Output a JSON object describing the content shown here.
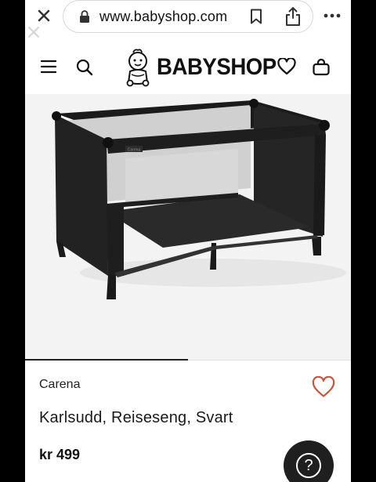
{
  "browser": {
    "url": "www.babyshop.com",
    "icons": [
      "close-icon",
      "lock-icon",
      "bookmark-icon",
      "share-icon",
      "more-icon"
    ]
  },
  "header": {
    "logo_text": "BABYSHOP",
    "icons": [
      "menu-icon",
      "search-icon",
      "heart-icon",
      "bag-icon"
    ]
  },
  "product": {
    "brand": "Carena",
    "title": "Karlsudd, Reiseseng, Svart",
    "price": "kr 499",
    "image_label": "Carena"
  },
  "help": {
    "symbol": "?"
  },
  "colors": {
    "accent": "#c7553f",
    "dark": "#1f1f1f",
    "image_bg": "#f3f3f3"
  }
}
